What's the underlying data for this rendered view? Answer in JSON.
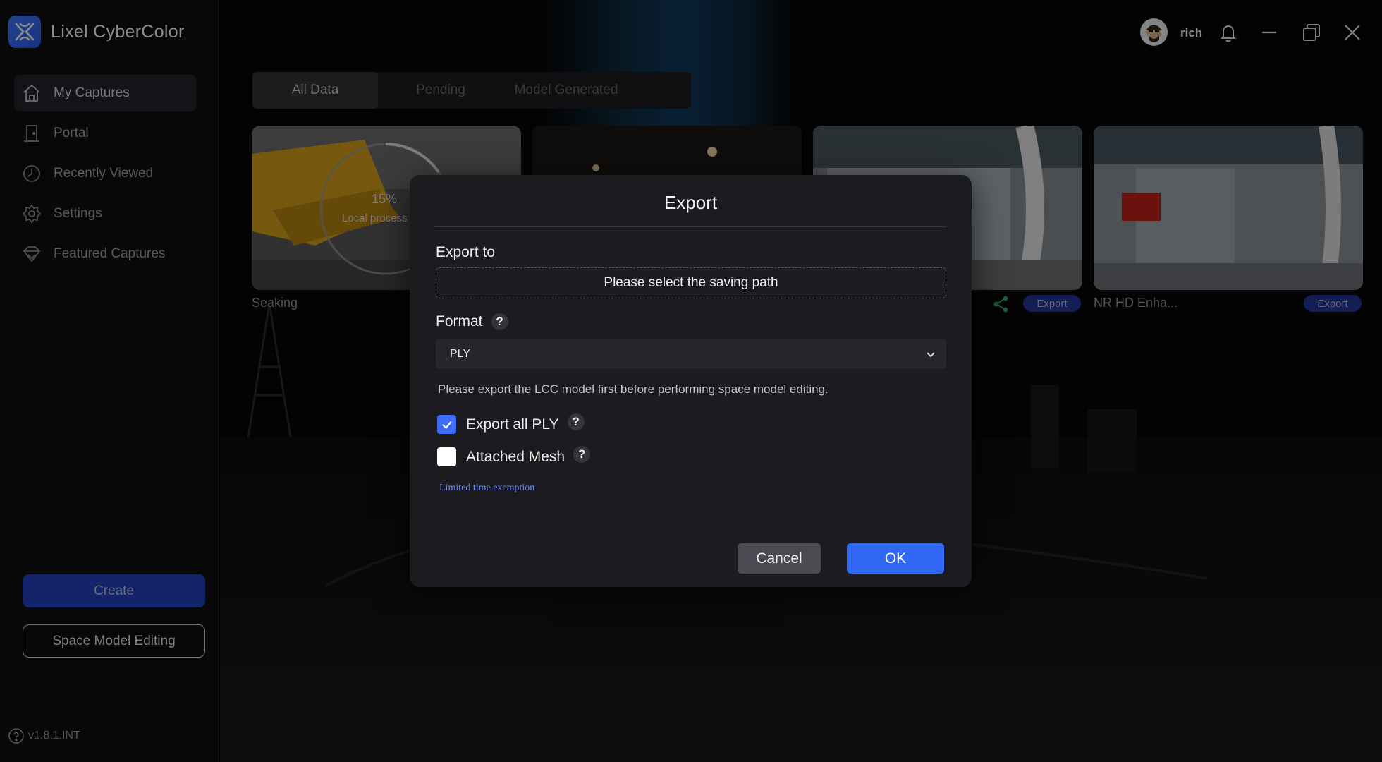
{
  "app": {
    "name": "Lixel CyberColor",
    "version": "v1.8.1.INT"
  },
  "sidebar": {
    "items": [
      {
        "label": "My Captures",
        "icon": "home-icon"
      },
      {
        "label": "Portal",
        "icon": "door-icon"
      },
      {
        "label": "Recently Viewed",
        "icon": "clock-icon"
      },
      {
        "label": "Settings",
        "icon": "gear-icon"
      },
      {
        "label": "Featured Captures",
        "icon": "diamond-icon"
      }
    ],
    "create_label": "Create",
    "space_model_label": "Space Model Editing"
  },
  "header": {
    "username": "rich"
  },
  "tabs": [
    {
      "label": "All Data"
    },
    {
      "label": "Pending"
    },
    {
      "label": "Model Generated"
    }
  ],
  "cards": [
    {
      "title": "Seaking",
      "progress_label": "15%",
      "status": "Local process"
    },
    {
      "title": ""
    },
    {
      "title": "",
      "export_label": "Export"
    },
    {
      "title": "NR HD Enha...",
      "export_label": "Export"
    }
  ],
  "dialog": {
    "title": "Export",
    "export_to_label": "Export to",
    "path_placeholder": "Please select the saving path",
    "format_label": "Format",
    "help_glyph": "?",
    "format_value": "PLY",
    "note": "Please export the LCC model first before performing space model editing.",
    "export_all_label": "Export all PLY",
    "export_all_checked": true,
    "attached_mesh_label": "Attached Mesh",
    "attached_mesh_checked": false,
    "exemption_link": "Limited time exemption",
    "cancel_label": "Cancel",
    "ok_label": "OK"
  },
  "colors": {
    "accent": "#2f68f2",
    "create_button": "#2443c2",
    "dialog_bg": "#1b1b20",
    "sidebar_bg": "#0f0f12",
    "link": "#6f8ff5"
  }
}
